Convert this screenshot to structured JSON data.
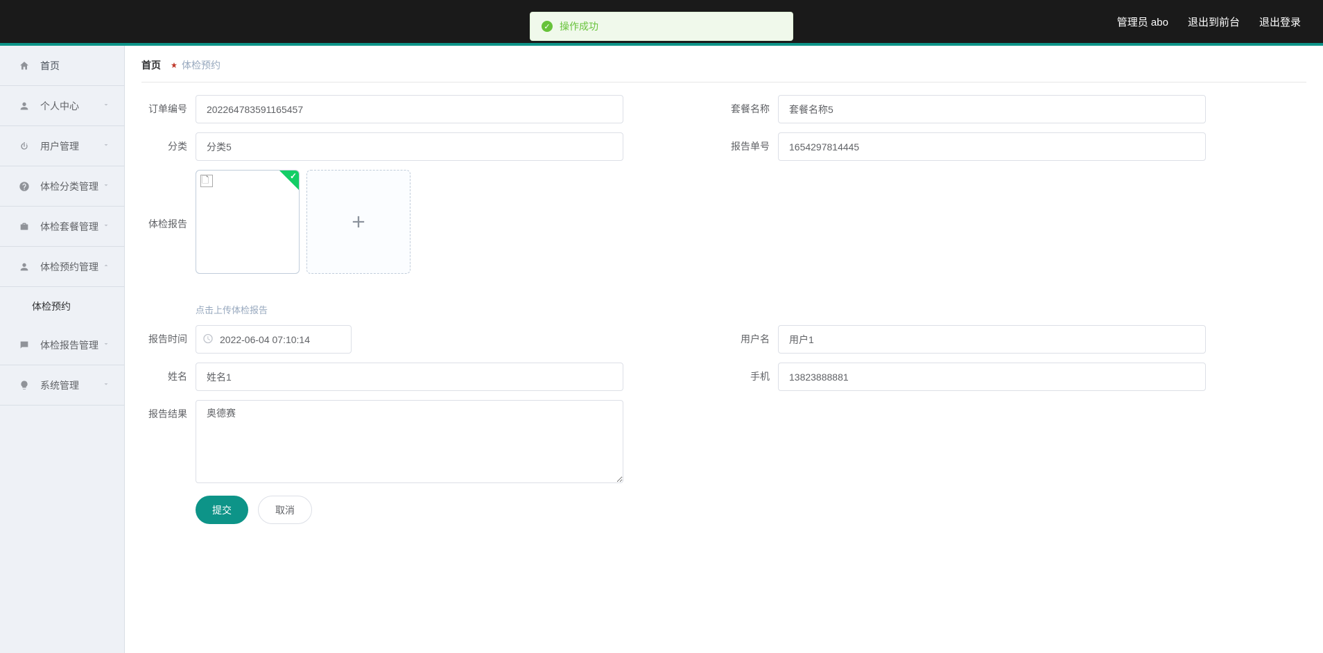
{
  "header": {
    "admin_label": "管理员 abo",
    "exit_front_label": "退出到前台",
    "logout_label": "退出登录"
  },
  "toast": {
    "text": "操作成功"
  },
  "sidebar": {
    "home_label": "首页",
    "items": [
      {
        "label": "个人中心",
        "icon": "user"
      },
      {
        "label": "用户管理",
        "icon": "power"
      },
      {
        "label": "体检分类管理",
        "icon": "question"
      },
      {
        "label": "体检套餐管理",
        "icon": "briefcase"
      },
      {
        "label": "体检预约管理",
        "icon": "user",
        "expanded": true,
        "children": [
          {
            "label": "体检预约"
          }
        ]
      },
      {
        "label": "体检报告管理",
        "icon": "chat"
      },
      {
        "label": "系统管理",
        "icon": "bulb"
      }
    ]
  },
  "breadcrumb": {
    "home": "首页",
    "current": "体检预约"
  },
  "form": {
    "order_no": {
      "label": "订单编号",
      "value": "202264783591165457"
    },
    "package_name": {
      "label": "套餐名称",
      "value": "套餐名称5"
    },
    "category": {
      "label": "分类",
      "value": "分类5"
    },
    "report_no": {
      "label": "报告单号",
      "value": "1654297814445"
    },
    "report_file": {
      "label": "体检报告",
      "tip": "点击上传体检报告"
    },
    "report_time": {
      "label": "报告时间",
      "value": "2022-06-04 07:10:14"
    },
    "user": {
      "label": "用户名",
      "value": "用户1"
    },
    "name": {
      "label": "姓名",
      "value": "姓名1"
    },
    "phone": {
      "label": "手机",
      "value": "13823888881"
    },
    "result": {
      "label": "报告结果",
      "value": "奥德赛"
    }
  },
  "actions": {
    "submit": "提交",
    "cancel": "取消"
  }
}
